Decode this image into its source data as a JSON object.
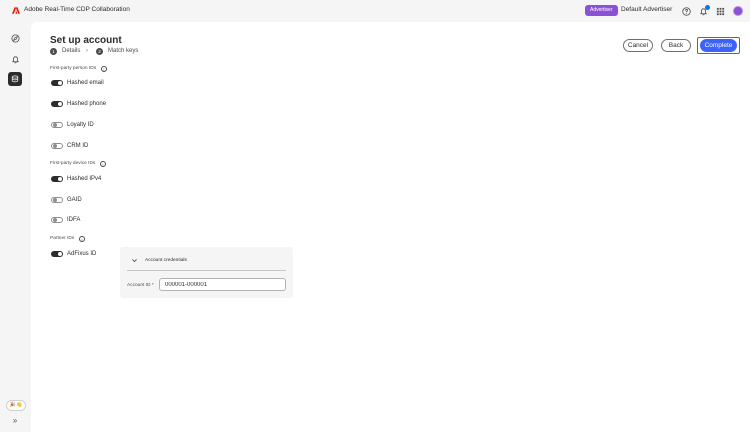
{
  "header": {
    "app_title": "Adobe Real-Time CDP Collaboration",
    "badge": "Advertiser",
    "account_name": "Default Advertiser",
    "icons": [
      "help-icon",
      "bell-icon",
      "apps-grid-icon",
      "avatar"
    ]
  },
  "rail": {
    "items": [
      "compass-icon",
      "bell-outline-icon",
      "data-icon"
    ],
    "emoji": "🎉👋",
    "expand": "»"
  },
  "page": {
    "title": "Set up account",
    "steps": [
      {
        "num": "1",
        "label": "Details"
      },
      {
        "num": "2",
        "label": "Match keys"
      }
    ],
    "step_separator": "›"
  },
  "actions": {
    "cancel": "Cancel",
    "back": "Back",
    "complete": "Complete"
  },
  "sections": {
    "person": {
      "label": "First-party person IDs",
      "items": [
        {
          "label": "Hashed email",
          "on": true
        },
        {
          "label": "Hashed phone",
          "on": true
        },
        {
          "label": "Loyalty ID",
          "on": false
        },
        {
          "label": "CRM ID",
          "on": false
        }
      ]
    },
    "device": {
      "label": "First-party device IDs",
      "items": [
        {
          "label": "Hashed IPv4",
          "on": true
        },
        {
          "label": "GAID",
          "on": false
        },
        {
          "label": "IDFA",
          "on": false
        }
      ]
    },
    "partner": {
      "label": "Partner IDs",
      "items": [
        {
          "label": "AdFixus ID",
          "on": true
        }
      ]
    }
  },
  "credentials": {
    "title": "Account credentials",
    "account_id_label": "Account ID",
    "required_mark": "*",
    "account_id_value": "000001-000001"
  },
  "info_glyph": "i",
  "colors": {
    "accent": "#3b63fb",
    "badge": "#8c52d6",
    "highlight": "#d7373f",
    "brand": "#eb1000"
  }
}
